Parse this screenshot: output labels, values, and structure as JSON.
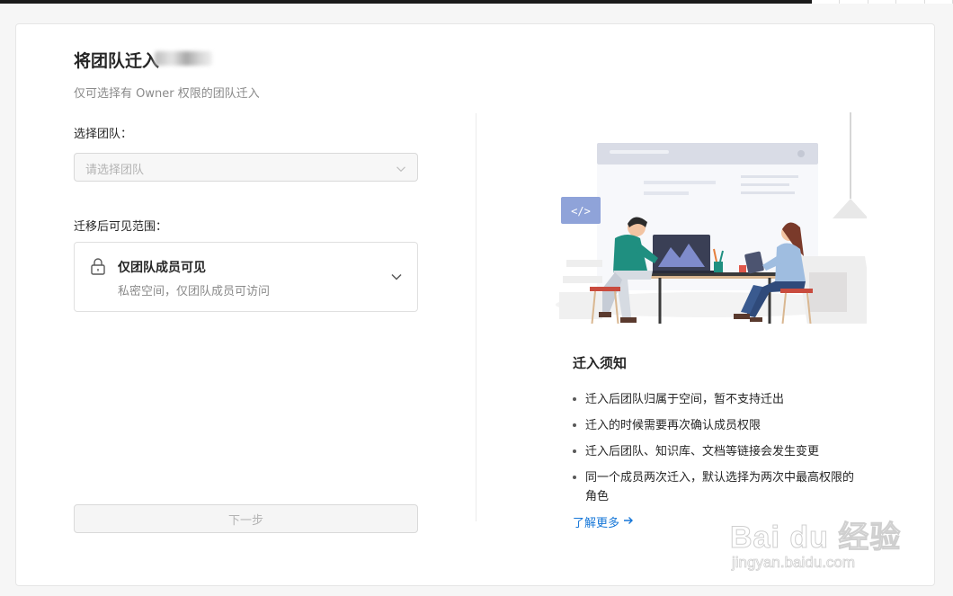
{
  "page": {
    "title": "将团队迁入",
    "subtitle": "仅可选择有 Owner 权限的团队迁入"
  },
  "team_field": {
    "label": "选择团队：",
    "placeholder": "请选择团队"
  },
  "visibility_field": {
    "label": "迁移后可见范围：",
    "selected_title": "仅团队成员可见",
    "selected_desc": "私密空间，仅团队成员可访问"
  },
  "next_button": {
    "label": "下一步",
    "disabled": true
  },
  "notice": {
    "title": "迁入须知",
    "items": [
      "迁入后团队归属于空间，暂不支持迁出",
      "迁入的时候需要再次确认成员权限",
      "迁入后团队、知识库、文档等链接会发生变更",
      "同一个成员两次迁入，默认选择为两次中最高权限的角色"
    ],
    "learn_more": "了解更多"
  },
  "watermark": {
    "brand": "Bai du 经验",
    "url": "jingyan.baidu.com"
  },
  "colors": {
    "link": "#1677d8",
    "illustration_blue": "#8fa3d9",
    "illustration_green": "#1f8f80"
  }
}
